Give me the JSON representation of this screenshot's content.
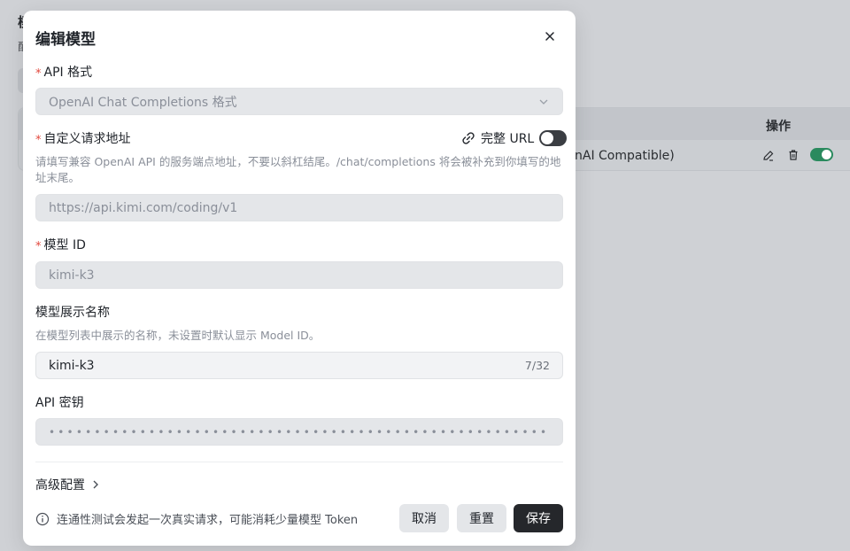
{
  "background": {
    "heading": "模",
    "subheading": "配",
    "table": {
      "actions_header": "操作",
      "row_provider": "nAI Compatible)"
    }
  },
  "modal": {
    "title": "编辑模型",
    "api_format": {
      "label": "API 格式",
      "value": "OpenAI Chat Completions 格式"
    },
    "custom_url": {
      "label": "自定义请求地址",
      "full_url_label": "完整 URL",
      "full_url_enabled": false,
      "hint": "请填写兼容 OpenAI API 的服务端点地址，不要以斜杠结尾。/chat/completions 将会被补充到你填写的地址末尾。",
      "value": "https://api.kimi.com/coding/v1"
    },
    "model_id": {
      "label": "模型 ID",
      "value": "kimi-k3"
    },
    "display_name": {
      "label": "模型展示名称",
      "hint": "在模型列表中展示的名称，未设置时默认显示 Model ID。",
      "value": "kimi-k3",
      "counter": "7/32"
    },
    "api_key": {
      "label": "API 密钥",
      "masked": "•••••••••••••••••••••••••••••••••••••••••••••••••••••••"
    },
    "advanced": {
      "label": "高级配置"
    },
    "footer": {
      "note": "连通性测试会发起一次真实请求，可能消耗少量模型 Token",
      "cancel": "取消",
      "reset": "重置",
      "save": "保存"
    }
  },
  "colors": {
    "required": "#e2483d",
    "primary_button": "#25272b",
    "enabled_toggle": "#2a8a5e"
  }
}
